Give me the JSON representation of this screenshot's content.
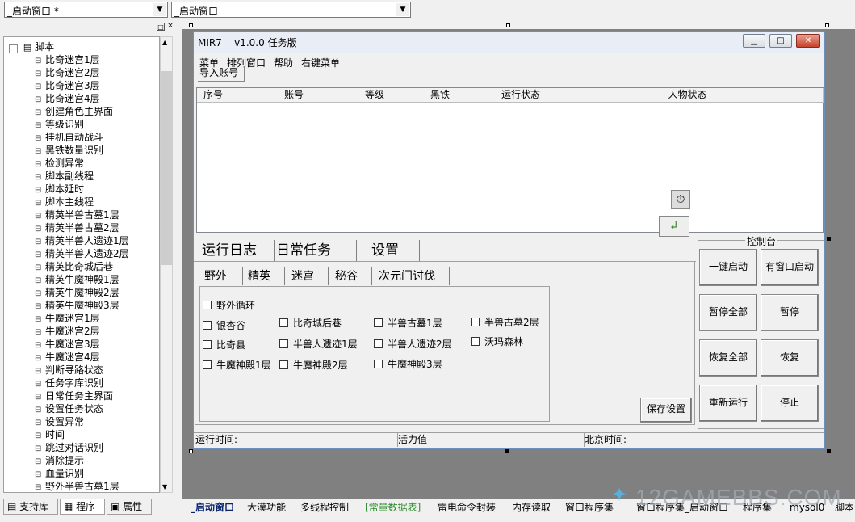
{
  "top": {
    "combo_left": "_启动窗口 *",
    "combo_right": "_启动窗口"
  },
  "tree": {
    "root": "脚本",
    "items": [
      "比奇迷宫1层",
      "比奇迷宫2层",
      "比奇迷宫3层",
      "比奇迷宫4层",
      "创建角色主界面",
      "等级识别",
      "挂机自动战斗",
      "黑铁数量识别",
      "检测异常",
      "脚本副线程",
      "脚本延时",
      "脚本主线程",
      "精英半兽古墓1层",
      "精英半兽古墓2层",
      "精英半兽人遗迹1层",
      "精英半兽人遗迹2层",
      "精英比奇城后巷",
      "精英牛魔神殿1层",
      "精英牛魔神殿2层",
      "精英牛魔神殿3层",
      "牛魔迷宫1层",
      "牛魔迷宫2层",
      "牛魔迷宫3层",
      "牛魔迷宫4层",
      "判断寻路状态",
      "任务字库识别",
      "日常任务主界面",
      "设置任务状态",
      "设置异常",
      "时间",
      "跳过对话识别",
      "消除提示",
      "血量识别",
      "野外半兽古墓1层"
    ]
  },
  "left_tabs": [
    "支持库",
    "程序",
    "属性"
  ],
  "window": {
    "title": "MIR7    v1.0.0 任务版",
    "menu": [
      "菜单",
      "排列窗口",
      "帮助",
      "右键菜单"
    ],
    "import_button": "导入账号",
    "grid_headers": [
      "序号",
      "账号",
      "等级",
      "黑铁",
      "运行状态",
      "人物状态"
    ],
    "main_tabs": [
      "运行日志",
      "日常任务",
      "设置"
    ],
    "sub_tabs": [
      "野外",
      "精英",
      "迷宫",
      "秘谷",
      "次元门讨伐"
    ],
    "checkboxes": {
      "loop": "野外循环",
      "row1": [
        "银杏谷",
        "比奇城后巷",
        "半兽古墓1层",
        "半兽古墓2层"
      ],
      "row2": [
        "比奇县",
        "半兽人遗迹1层",
        "半兽人遗迹2层",
        "沃玛森林"
      ],
      "row3": [
        "牛魔神殿1层",
        "牛魔神殿2层",
        "牛魔神殿3层"
      ]
    },
    "save_button": "保存设置",
    "console": {
      "title": "控制台",
      "buttons": [
        "一键启动",
        "有窗口启动",
        "暂停全部",
        "暂停",
        "恢复全部",
        "恢复",
        "重新运行",
        "停止"
      ]
    },
    "status": [
      "运行时间:",
      "活力值",
      "北京时间:"
    ]
  },
  "bottom_tabs": [
    "_启动窗口",
    "大漠功能",
    "多线程控制",
    "[常量数据表]",
    "雷电命令封装",
    "内存读取",
    "窗口程序集",
    "窗口程序集_启动窗口",
    "程序集",
    "mysol0",
    "脚本"
  ],
  "watermark": "12GAMEBBS.COM"
}
